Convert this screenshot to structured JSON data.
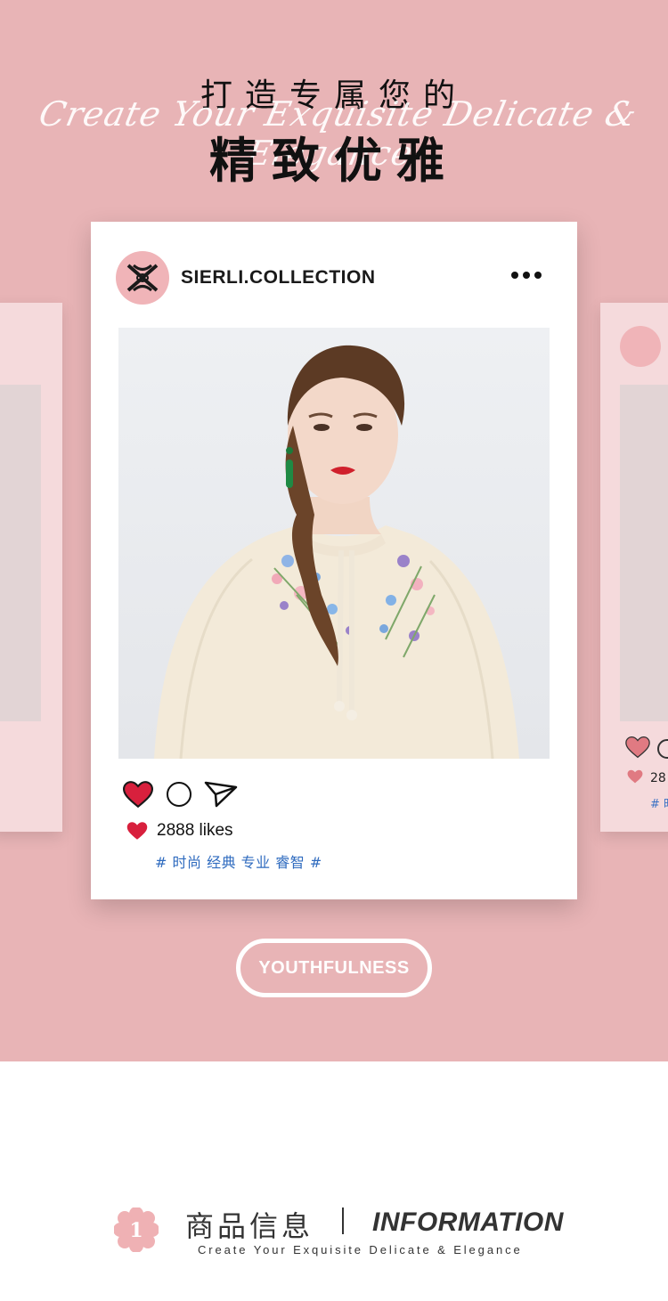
{
  "header": {
    "title_line1": "打造专属您的",
    "script_line": "Create Your Exquisite Delicate & Elegance",
    "title_line2": "精致优雅"
  },
  "post": {
    "username": "SIERLI.COLLECTION",
    "likes": "2888 likes",
    "tags": "# 时尚 经典 专业 睿智 #",
    "icons": [
      "brand-logo-icon",
      "more-icon",
      "heart-icon",
      "comment-icon",
      "share-icon"
    ]
  },
  "side_card_right": {
    "likes": "28",
    "tag": "# 时"
  },
  "button": {
    "label": "YOUTHFULNESS"
  },
  "info": {
    "number": "1",
    "title_cn": "商品信息",
    "title_en": "INFORMATION",
    "subtitle": "Create Your Exquisite Delicate & Elegance"
  },
  "colors": {
    "background_pink": "#e8b4b6",
    "card_pink": "#f5dadc",
    "heart_red": "#d8203d",
    "tag_blue": "#2f6bbf"
  }
}
